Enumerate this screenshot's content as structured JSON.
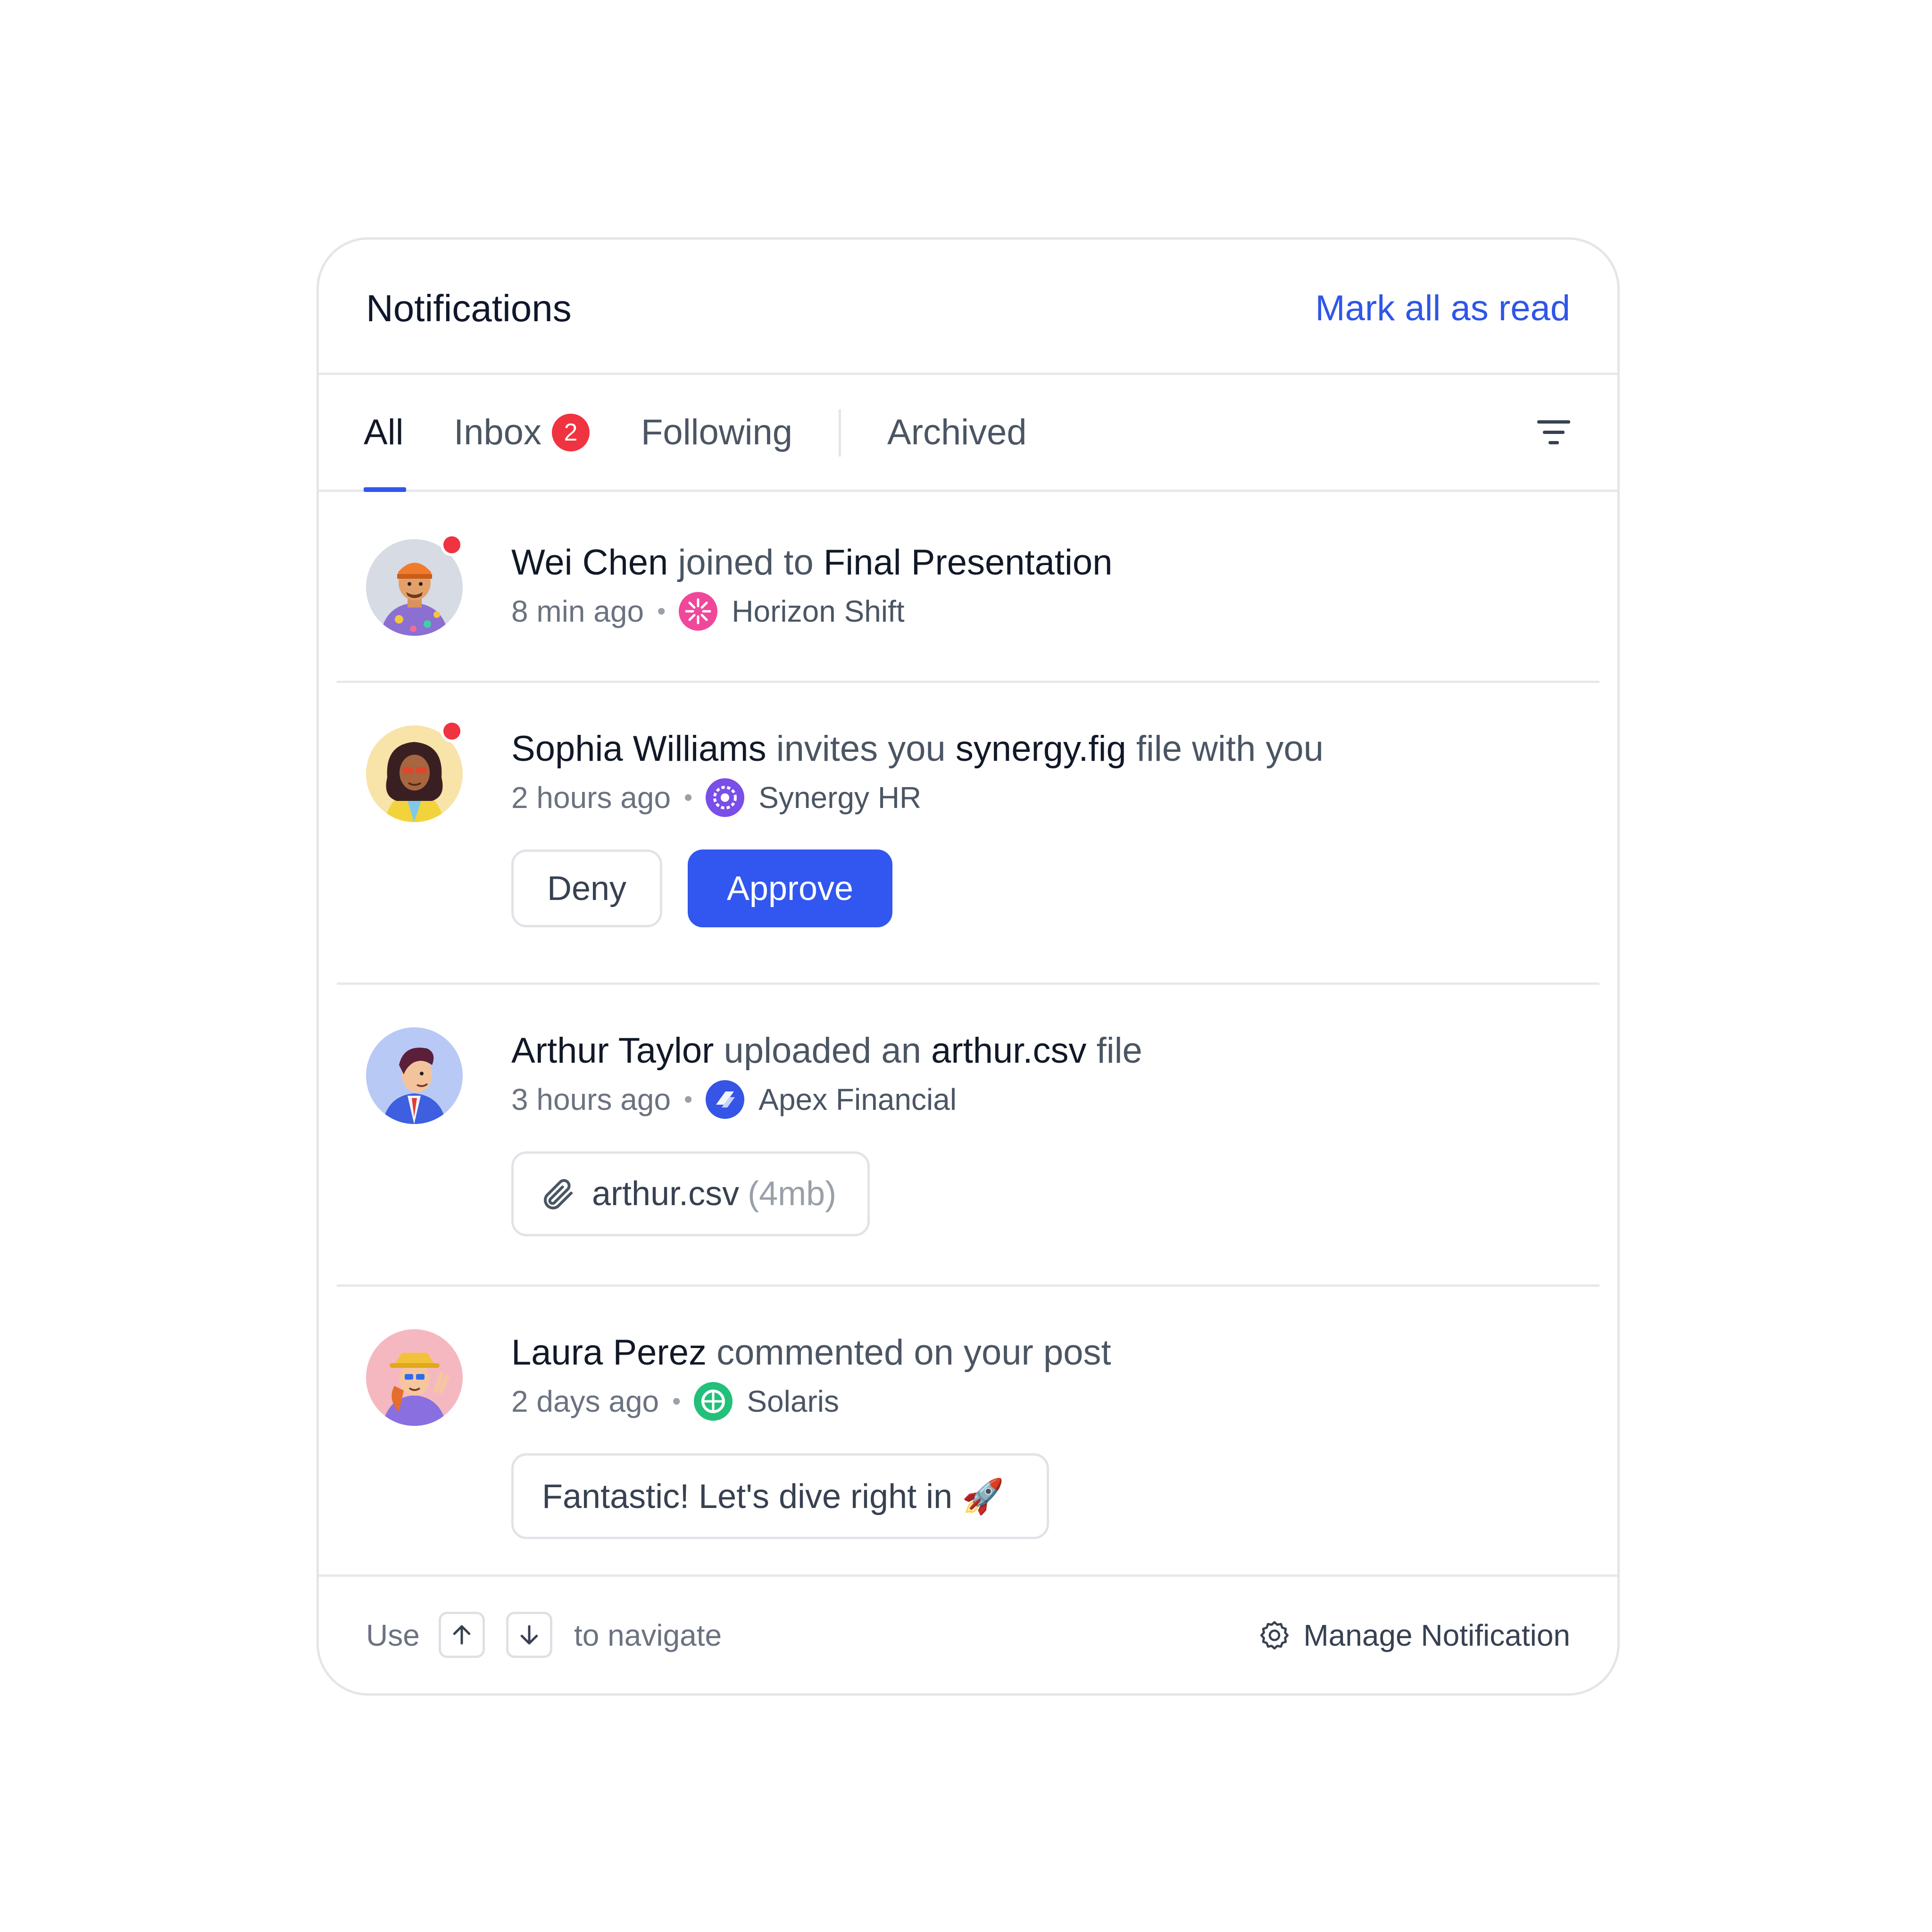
{
  "header": {
    "title": "Notifications",
    "mark_all": "Mark all as read"
  },
  "tabs": [
    {
      "label": "All"
    },
    {
      "label": "Inbox",
      "badge": "2"
    },
    {
      "label": "Following"
    },
    {
      "label": "Archived"
    }
  ],
  "notifications": [
    {
      "actor": "Wei Chen",
      "verb": " joined to ",
      "target": "Final Presentation",
      "suffix": "",
      "time": "8 min ago",
      "org": "Horizon Shift",
      "unread": true
    },
    {
      "actor": "Sophia Williams",
      "verb": " invites you ",
      "target": "synergy.fig",
      "suffix": " file with you",
      "time": "2 hours ago",
      "org": "Synergy HR",
      "unread": true,
      "actions": {
        "deny": "Deny",
        "approve": "Approve"
      }
    },
    {
      "actor": "Arthur Taylor",
      "verb": " uploaded an ",
      "target": "arthur.csv",
      "suffix": " file",
      "time": "3 hours ago",
      "org": "Apex Financial",
      "unread": false,
      "attachment": {
        "name": "arthur.csv",
        "size": "(4mb)"
      }
    },
    {
      "actor": "Laura Perez",
      "verb": " commented on your post",
      "target": "",
      "suffix": "",
      "time": "2 days ago",
      "org": "Solaris",
      "unread": false,
      "comment": "Fantastic! Let's dive right in 🚀"
    }
  ],
  "footer": {
    "use": "Use",
    "navigate": "to navigate",
    "manage": "Manage Notification"
  },
  "colors": {
    "accent": "#3157f0",
    "badge": "#ef3340",
    "link": "#2f56e8"
  }
}
